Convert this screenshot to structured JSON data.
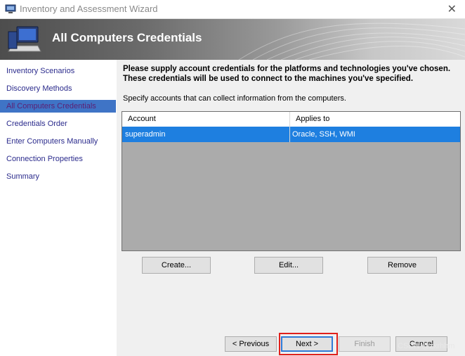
{
  "window": {
    "title": "Inventory and Assessment Wizard",
    "close_glyph": "✕"
  },
  "banner": {
    "title": "All Computers Credentials"
  },
  "sidebar": {
    "items": [
      {
        "label": "Inventory Scenarios",
        "active": false
      },
      {
        "label": "Discovery Methods",
        "active": false
      },
      {
        "label": "All Computers Credentials",
        "active": true
      },
      {
        "label": "Credentials Order",
        "active": false
      },
      {
        "label": "Enter Computers Manually",
        "active": false
      },
      {
        "label": "Connection Properties",
        "active": false
      },
      {
        "label": "Summary",
        "active": false
      }
    ]
  },
  "main": {
    "headline": "Please supply account credentials for the platforms and technologies you've chosen. These credentials will be used to connect to the machines you've specified.",
    "subtext": "Specify accounts that can collect information from the computers.",
    "table": {
      "columns": [
        "Account",
        "Applies to"
      ],
      "rows": [
        {
          "account": "superadmin",
          "applies_to": "Oracle, SSH, WMI"
        }
      ]
    },
    "buttons": {
      "create": "Create...",
      "edit": "Edit...",
      "remove": "Remove"
    }
  },
  "footer": {
    "previous": "< Previous",
    "next": "Next >",
    "finish": "Finish",
    "cancel": "Cancel"
  },
  "watermark": "CSDN @zxrhhm",
  "colors": {
    "selection": "#1e7fe0",
    "nav_active": "#3f74c6",
    "highlight": "#e0201b"
  }
}
